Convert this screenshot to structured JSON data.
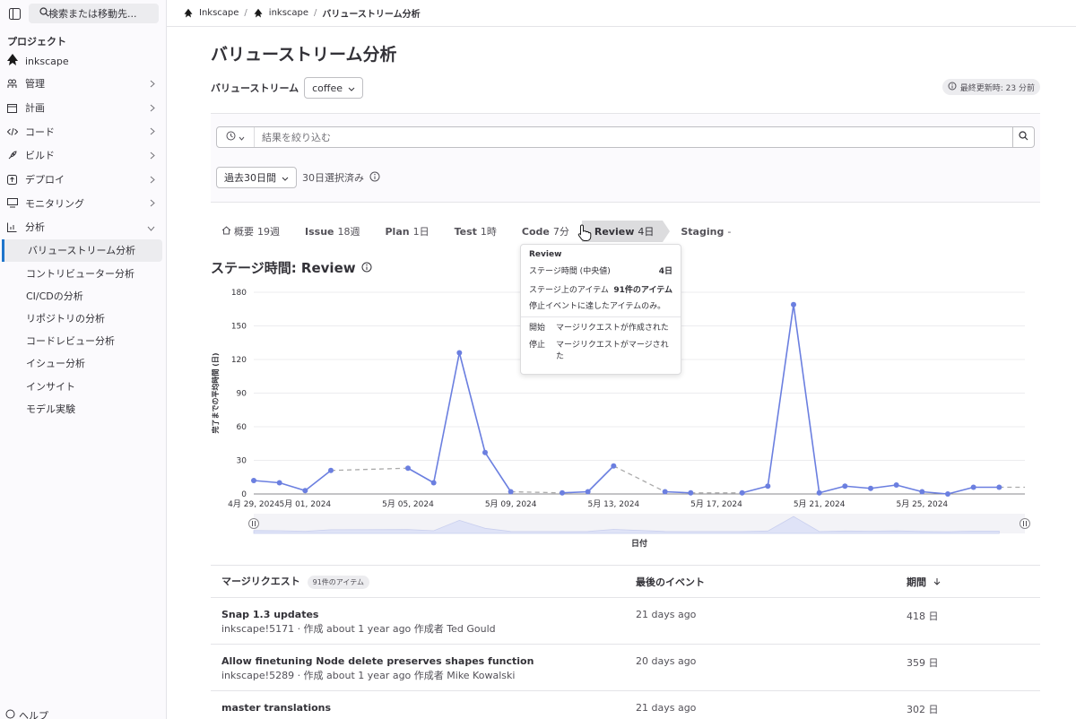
{
  "sidebar": {
    "search_label": "検索または移動先...",
    "section_title": "プロジェクト",
    "project_name": "inkscape",
    "items": [
      {
        "label": "管理",
        "icon": "users-icon"
      },
      {
        "label": "計画",
        "icon": "calendar-icon"
      },
      {
        "label": "コード",
        "icon": "code-icon"
      },
      {
        "label": "ビルド",
        "icon": "rocket-icon"
      },
      {
        "label": "デプロイ",
        "icon": "deploy-icon"
      },
      {
        "label": "モニタリング",
        "icon": "monitor-icon"
      },
      {
        "label": "分析",
        "icon": "chart-icon"
      }
    ],
    "sub_items": [
      "バリューストリーム分析",
      "コントリビューター分析",
      "CI/CDの分析",
      "リポジトリの分析",
      "コードレビュー分析",
      "イシュー分析",
      "インサイト",
      "モデル実験"
    ],
    "help_label": "ヘルプ"
  },
  "breadcrumb": {
    "items": [
      "Inkscape",
      "inkscape",
      "バリューストリーム分析"
    ]
  },
  "header": {
    "title": "バリューストリーム分析",
    "stream_label": "バリューストリーム",
    "stream_value": "coffee",
    "updated": "最終更新時: 23 分前"
  },
  "filter": {
    "placeholder": "結果を絞り込む",
    "date_range": "過去30日間",
    "selected_days": "30日選択済み"
  },
  "stages": [
    {
      "name": "概要",
      "value": "19週",
      "icon": "home-icon"
    },
    {
      "name": "Issue",
      "value": "18週"
    },
    {
      "name": "Plan",
      "value": "1日"
    },
    {
      "name": "Test",
      "value": "1時"
    },
    {
      "name": "Code",
      "value": "7分"
    },
    {
      "name": "Review",
      "value": "4日"
    },
    {
      "name": "Staging",
      "value": "-"
    }
  ],
  "stage_title": "ステージ時間: Review",
  "tooltip": {
    "title": "Review",
    "median_label": "ステージ時間 (中央値)",
    "median_value": "4日",
    "items_label": "ステージ上のアイテム",
    "items_value": "91件のアイテム",
    "note": "停止イベントに達したアイテムのみ。",
    "start_label": "開始",
    "start_value": "マージリクエストが作成された",
    "stop_label": "停止",
    "stop_value": "マージリクエストがマージされた"
  },
  "chart_data": {
    "type": "line",
    "ylabel": "完了までの平均時間 (日)",
    "xlabel": "日付",
    "ylim": [
      0,
      180
    ],
    "yticks": [
      0,
      30,
      60,
      90,
      120,
      150,
      180
    ],
    "x_tick_labels": [
      "4月 29, 2024",
      "5月 01, 2024",
      "5月 05, 2024",
      "5月 09, 2024",
      "5月 13, 2024",
      "5月 17, 2024",
      "5月 21, 2024",
      "5月 25, 2024"
    ],
    "x_range": [
      "2024-04-29",
      "2024-05-29"
    ],
    "series": [
      {
        "points": [
          {
            "x": "2024-04-29",
            "y": 12
          },
          {
            "x": "2024-04-30",
            "y": 10
          },
          {
            "x": "2024-05-01",
            "y": 3
          },
          {
            "x": "2024-05-02",
            "y": 21
          },
          {
            "x": "2024-05-05",
            "y": 23
          },
          {
            "x": "2024-05-06",
            "y": 10
          },
          {
            "x": "2024-05-07",
            "y": 126
          },
          {
            "x": "2024-05-08",
            "y": 37
          },
          {
            "x": "2024-05-09",
            "y": 2
          },
          {
            "x": "2024-05-11",
            "y": 1
          },
          {
            "x": "2024-05-12",
            "y": 2
          },
          {
            "x": "2024-05-13",
            "y": 25
          },
          {
            "x": "2024-05-15",
            "y": 2
          },
          {
            "x": "2024-05-16",
            "y": 1
          },
          {
            "x": "2024-05-18",
            "y": 1
          },
          {
            "x": "2024-05-19",
            "y": 7
          },
          {
            "x": "2024-05-20",
            "y": 169
          },
          {
            "x": "2024-05-21",
            "y": 1
          },
          {
            "x": "2024-05-22",
            "y": 7
          },
          {
            "x": "2024-05-23",
            "y": 5
          },
          {
            "x": "2024-05-24",
            "y": 8
          },
          {
            "x": "2024-05-25",
            "y": 2
          },
          {
            "x": "2024-05-26",
            "y": 0
          },
          {
            "x": "2024-05-27",
            "y": 6
          },
          {
            "x": "2024-05-28",
            "y": 6
          }
        ]
      }
    ],
    "colors": {
      "line": "#6b7fe0",
      "gap": "#aaaaaa"
    }
  },
  "table": {
    "col1": "マージリクエスト",
    "col1_badge": "91件のアイテム",
    "col2": "最後のイベント",
    "col3": "期間",
    "rows": [
      {
        "title": "Snap 1.3 updates",
        "meta": "inkscape!5171 · 作成 about 1 year ago 作成者 Ted Gould",
        "last": "21 days ago",
        "duration": "418 日"
      },
      {
        "title": "Allow finetuning Node delete preserves shapes function",
        "meta": "inkscape!5289 · 作成 about 1 year ago 作成者 Mike Kowalski",
        "last": "20 days ago",
        "duration": "359 日"
      },
      {
        "title": "master translations",
        "meta": "",
        "last": "21 days ago",
        "duration": "302 日"
      }
    ]
  }
}
